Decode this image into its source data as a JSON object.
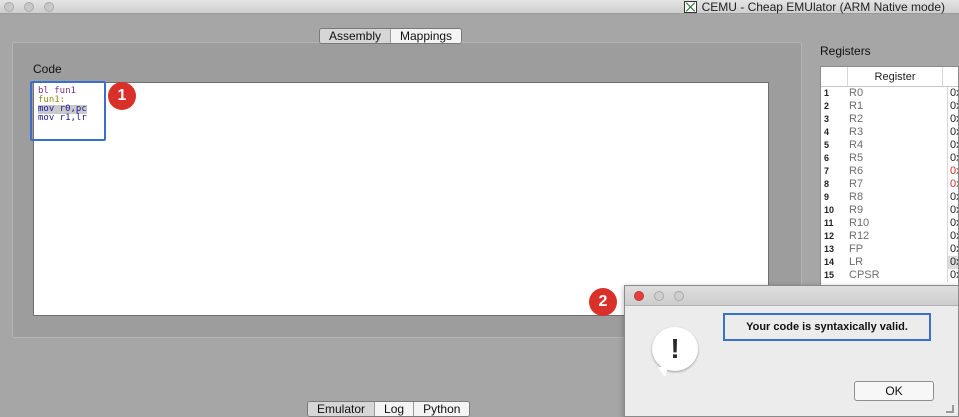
{
  "window": {
    "title": "CEMU - Cheap EMUlator (ARM Native mode)"
  },
  "top_tabs": [
    {
      "label": "Assembly",
      "active": true
    },
    {
      "label": "Mappings",
      "active": false
    }
  ],
  "code": {
    "label": "Code",
    "lines": [
      "bl fun1",
      "fun1:",
      "mov r0,pc",
      "mov r1,lr"
    ]
  },
  "annotations": {
    "badge_1": "1",
    "badge_2": "2"
  },
  "registers": {
    "label": "Registers",
    "header": "Register",
    "rows": [
      {
        "num": "1",
        "name": "R0",
        "value": "0x"
      },
      {
        "num": "2",
        "name": "R1",
        "value": "0x"
      },
      {
        "num": "3",
        "name": "R2",
        "value": "0x"
      },
      {
        "num": "4",
        "name": "R3",
        "value": "0x"
      },
      {
        "num": "5",
        "name": "R4",
        "value": "0x"
      },
      {
        "num": "6",
        "name": "R5",
        "value": "0x"
      },
      {
        "num": "7",
        "name": "R6",
        "value": "0x"
      },
      {
        "num": "8",
        "name": "R7",
        "value": "0x"
      },
      {
        "num": "9",
        "name": "R8",
        "value": "0x"
      },
      {
        "num": "10",
        "name": "R9",
        "value": "0x"
      },
      {
        "num": "11",
        "name": "R10",
        "value": "0x"
      },
      {
        "num": "12",
        "name": "R12",
        "value": "0x"
      },
      {
        "num": "13",
        "name": "FP",
        "value": "0x"
      },
      {
        "num": "14",
        "name": "LR",
        "value": "0x"
      },
      {
        "num": "15",
        "name": "CPSR",
        "value": "0x"
      }
    ],
    "changed_color": "#c23030"
  },
  "dialog": {
    "message": "Your code is syntaxically valid.",
    "ok_label": "OK",
    "icon": "exclamation-icon"
  },
  "bottom_tabs": [
    {
      "label": "Emulator",
      "active": true
    },
    {
      "label": "Log",
      "active": false
    },
    {
      "label": "Python",
      "active": false
    }
  ],
  "colors": {
    "highlight_border": "#3a6fd0",
    "badge": "#d9302a"
  }
}
